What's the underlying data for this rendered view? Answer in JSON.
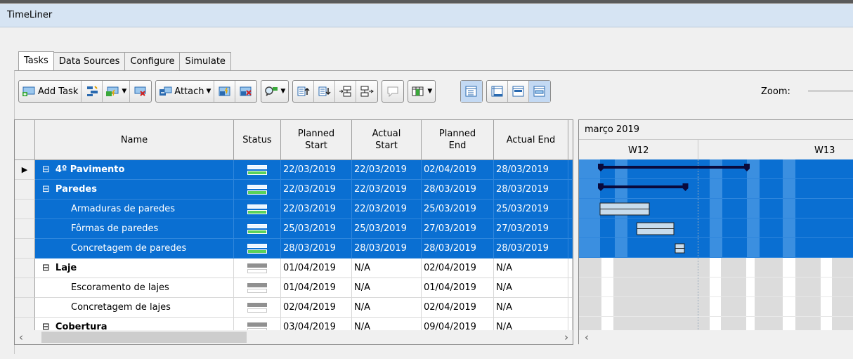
{
  "window": {
    "title": "TimeLiner"
  },
  "tabs": [
    {
      "label": "Tasks",
      "active": true
    },
    {
      "label": "Data Sources",
      "active": false
    },
    {
      "label": "Configure",
      "active": false
    },
    {
      "label": "Simulate",
      "active": false
    }
  ],
  "toolbar": {
    "add_task_label": "Add Task",
    "attach_label": "Attach",
    "zoom_label": "Zoom:"
  },
  "grid": {
    "headers": {
      "name": "Name",
      "status": "Status",
      "planned_start": "Planned Start",
      "actual_start": "Actual Start",
      "planned_end": "Planned End",
      "actual_end": "Actual End"
    },
    "rows": [
      {
        "name": "4º Pavimento",
        "level": 0,
        "bold": true,
        "expand": "minus",
        "selected": true,
        "current": true,
        "planned_start": "22/03/2019",
        "actual_start": "22/03/2019",
        "planned_end": "02/04/2019",
        "actual_end": "28/03/2019"
      },
      {
        "name": "Paredes",
        "level": 0,
        "bold": true,
        "expand": "minus",
        "selected": true,
        "current": false,
        "planned_start": "22/03/2019",
        "actual_start": "22/03/2019",
        "planned_end": "28/03/2019",
        "actual_end": "28/03/2019"
      },
      {
        "name": "Armaduras de paredes",
        "level": 1,
        "bold": false,
        "expand": "",
        "selected": true,
        "current": false,
        "planned_start": "22/03/2019",
        "actual_start": "22/03/2019",
        "planned_end": "25/03/2019",
        "actual_end": "25/03/2019"
      },
      {
        "name": "Fôrmas de paredes",
        "level": 1,
        "bold": false,
        "expand": "",
        "selected": true,
        "current": false,
        "planned_start": "25/03/2019",
        "actual_start": "25/03/2019",
        "planned_end": "27/03/2019",
        "actual_end": "27/03/2019"
      },
      {
        "name": "Concretagem de paredes",
        "level": 1,
        "bold": false,
        "expand": "",
        "selected": true,
        "current": false,
        "planned_start": "28/03/2019",
        "actual_start": "28/03/2019",
        "planned_end": "28/03/2019",
        "actual_end": "28/03/2019"
      },
      {
        "name": "Laje",
        "level": 0,
        "bold": true,
        "expand": "minus",
        "selected": false,
        "current": false,
        "planned_start": "01/04/2019",
        "actual_start": "N/A",
        "planned_end": "02/04/2019",
        "actual_end": "N/A"
      },
      {
        "name": "Escoramento de lajes",
        "level": 1,
        "bold": false,
        "expand": "",
        "selected": false,
        "current": false,
        "planned_start": "01/04/2019",
        "actual_start": "N/A",
        "planned_end": "01/04/2019",
        "actual_end": "N/A"
      },
      {
        "name": "Concretagem de lajes",
        "level": 1,
        "bold": false,
        "expand": "",
        "selected": false,
        "current": false,
        "planned_start": "02/04/2019",
        "actual_start": "N/A",
        "planned_end": "02/04/2019",
        "actual_end": "N/A"
      },
      {
        "name": "Cobertura",
        "level": 0,
        "bold": true,
        "expand": "minus",
        "selected": false,
        "current": false,
        "planned_start": "03/04/2019",
        "actual_start": "N/A",
        "planned_end": "09/04/2019",
        "actual_end": "N/A"
      }
    ]
  },
  "gantt": {
    "month_label": "março 2019",
    "weeks": [
      "W12",
      "W13"
    ]
  },
  "colors": {
    "selection": "#0a6fd2",
    "selection_light": "#3b8fe0",
    "summary_bar": "#0a0a3c",
    "task_bar": "#c8dcec",
    "status_done_top": "#5ad25a",
    "status_gray": "#909090"
  },
  "icons": {
    "expand_minus": "⊟",
    "row_pointer": "▶",
    "scroll_left": "‹",
    "scroll_right": "›"
  }
}
